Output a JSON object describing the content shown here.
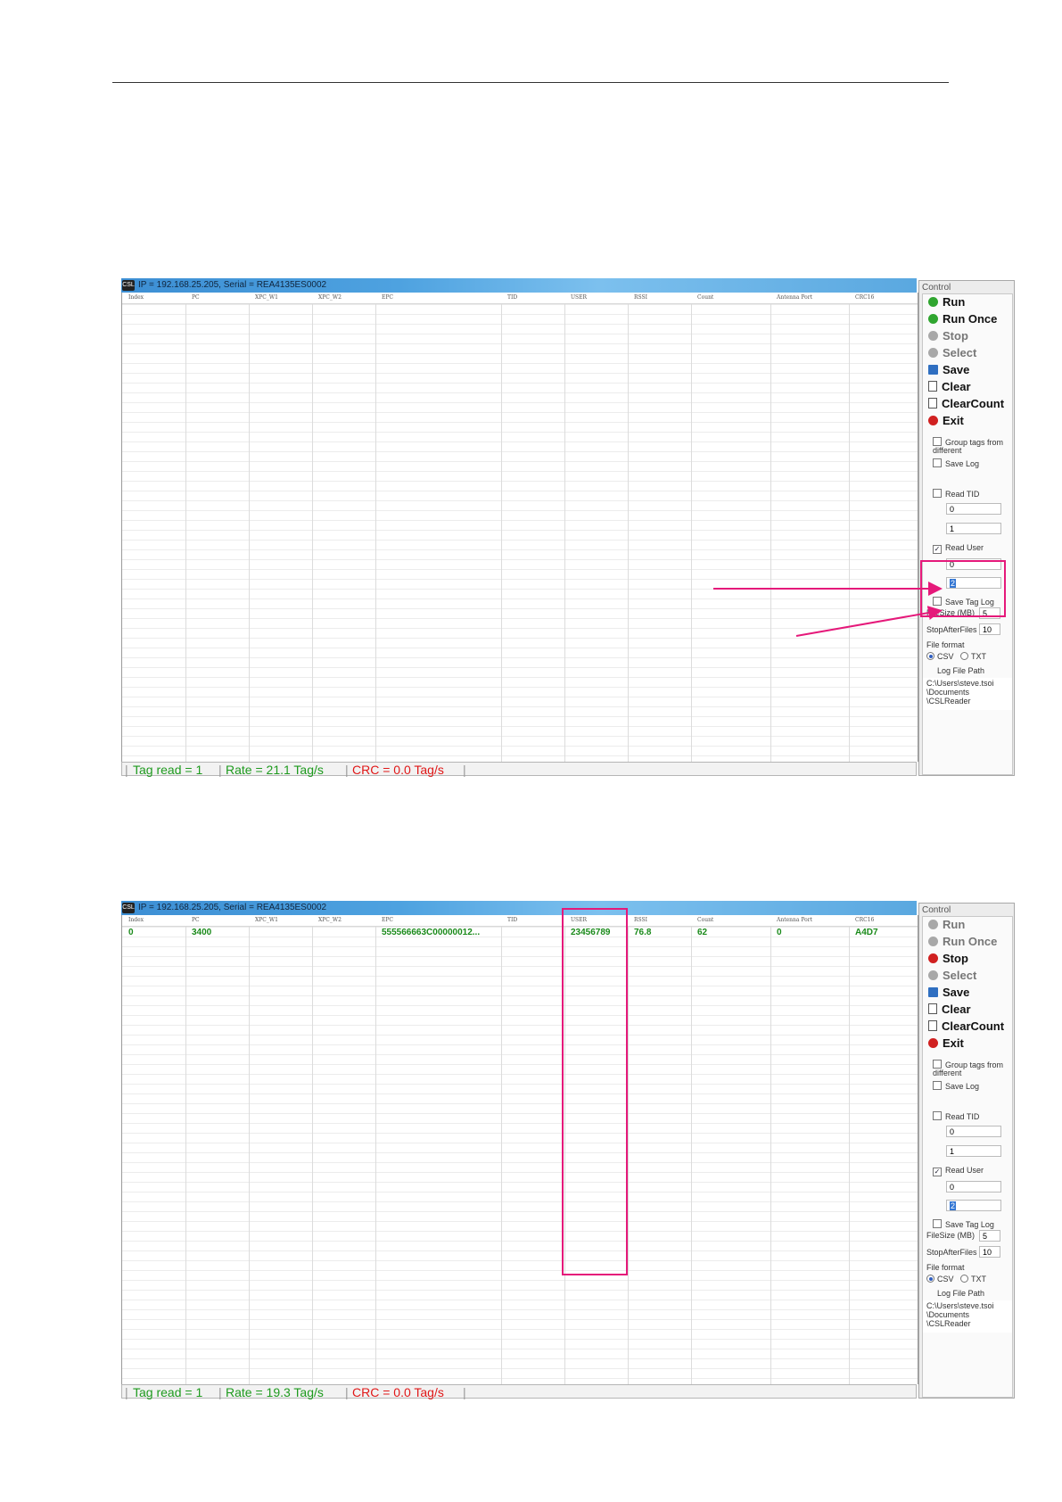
{
  "columns": [
    "Index",
    "PC",
    "XPC_W1",
    "XPC_W2",
    "EPC",
    "TID",
    "USER",
    "RSSI",
    "Count",
    "Antenna Port",
    "CRC16"
  ],
  "screenshot_1": {
    "title": "IP = 192.168.25.205, Serial = REA4135ES0002",
    "row": null,
    "status": {
      "tag_read": "Tag read = 1",
      "rate": "Rate = 21.1 Tag/s",
      "crc": "CRC = 0.0 Tag/s"
    },
    "control": {
      "title": "Control",
      "buttons": [
        {
          "label": "Run",
          "icon": "play-icon",
          "enabled": true
        },
        {
          "label": "Run Once",
          "icon": "play-icon",
          "enabled": true
        },
        {
          "label": "Stop",
          "icon": "stop-icon",
          "enabled": false
        },
        {
          "label": "Select",
          "icon": "select-icon",
          "enabled": false
        },
        {
          "label": "Save",
          "icon": "save-icon",
          "enabled": true
        },
        {
          "label": "Clear",
          "icon": "document-icon",
          "enabled": true
        },
        {
          "label": "ClearCount",
          "icon": "document-icon",
          "enabled": true
        },
        {
          "label": "Exit",
          "icon": "exit-icon",
          "enabled": true
        }
      ],
      "group_tags_label": "Group tags from different",
      "save_log_label": "Save Log",
      "read_tid_label": "Read TID",
      "tid_offset": "0",
      "tid_length": "1",
      "read_user_label": "Read User",
      "read_user_checked": true,
      "user_offset": "0",
      "user_length": "2",
      "save_tag_log_label": "Save Tag Log",
      "filesize_label": "FileSize (MB)",
      "filesize_value": "5",
      "stopafter_label": "StopAfterFiles",
      "stopafter_value": "10",
      "file_format_label": "File format",
      "csv_label": "CSV",
      "txt_label": "TXT",
      "log_path_label": "Log File Path",
      "log_path": "C:\\Users\\steve.tsoi\n\\Documents\n\\CSLReader"
    }
  },
  "screenshot_2": {
    "title": "IP = 192.168.25.205, Serial = REA4135ES0002",
    "row": {
      "index": "0",
      "pc": "3400",
      "xpc_w1": "",
      "xpc_w2": "",
      "epc": "555566663C00000012...",
      "tid": "",
      "user": "23456789",
      "rssi": "76.8",
      "count": "62",
      "antenna_port": "0",
      "crc16": "A4D7"
    },
    "status": {
      "tag_read": "Tag read = 1",
      "rate": "Rate = 19.3 Tag/s",
      "crc": "CRC = 0.0 Tag/s"
    },
    "control": {
      "title": "Control",
      "buttons": [
        {
          "label": "Run",
          "icon": "play-icon",
          "enabled": false
        },
        {
          "label": "Run Once",
          "icon": "play-icon",
          "enabled": false
        },
        {
          "label": "Stop",
          "icon": "stop-icon",
          "enabled": true
        },
        {
          "label": "Select",
          "icon": "select-icon",
          "enabled": false
        },
        {
          "label": "Save",
          "icon": "save-icon",
          "enabled": true
        },
        {
          "label": "Clear",
          "icon": "document-icon",
          "enabled": true
        },
        {
          "label": "ClearCount",
          "icon": "document-icon",
          "enabled": true
        },
        {
          "label": "Exit",
          "icon": "exit-icon",
          "enabled": true
        }
      ],
      "group_tags_label": "Group tags from different",
      "save_log_label": "Save Log",
      "read_tid_label": "Read TID",
      "tid_offset": "0",
      "tid_length": "1",
      "read_user_label": "Read User",
      "read_user_checked": true,
      "user_offset": "0",
      "user_length": "2",
      "save_tag_log_label": "Save Tag Log",
      "filesize_label": "FileSize (MB)",
      "filesize_value": "5",
      "stopafter_label": "StopAfterFiles",
      "stopafter_value": "10",
      "file_format_label": "File format",
      "csv_label": "CSV",
      "txt_label": "TXT",
      "log_path_label": "Log File Path",
      "log_path": "C:\\Users\\steve.tsoi\n\\Documents\n\\CSLReader"
    }
  },
  "annotation_color": "#e5197a"
}
